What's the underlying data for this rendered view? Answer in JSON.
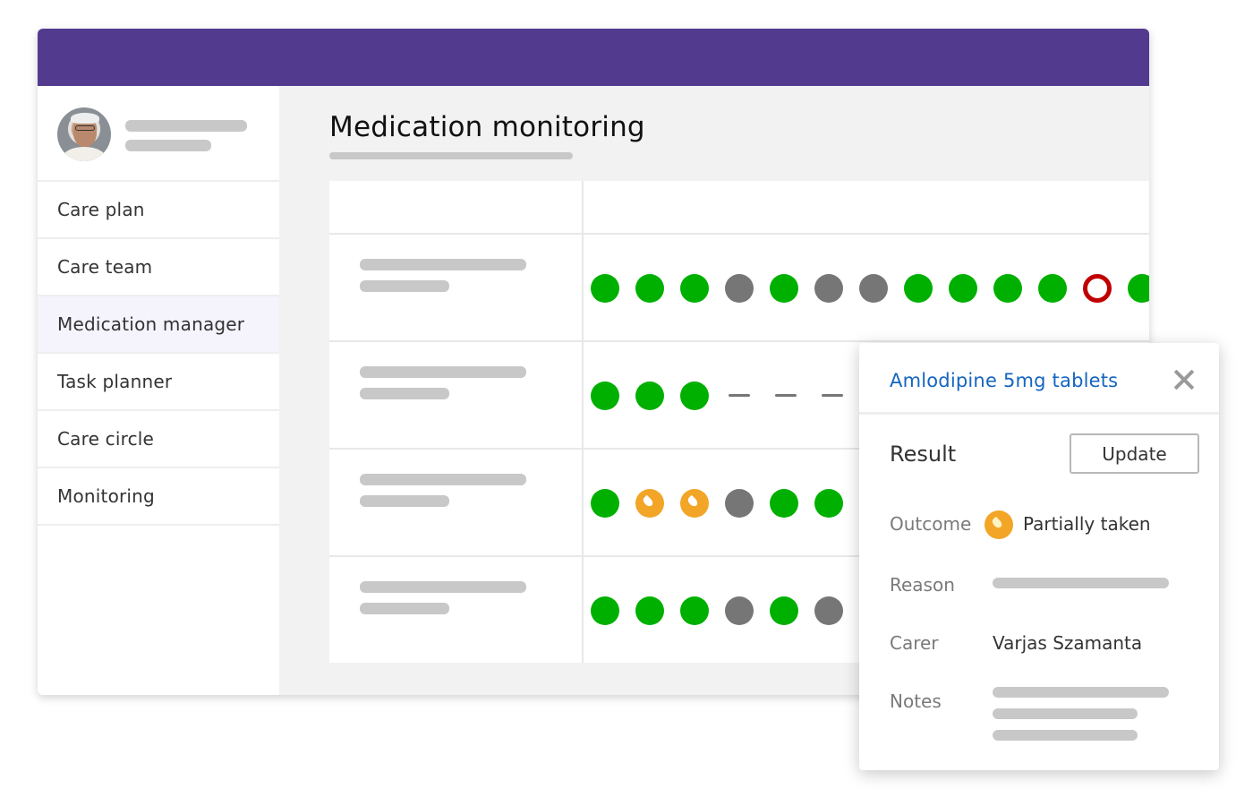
{
  "main": {
    "title": "Medication monitoring"
  },
  "sidebar": {
    "items": [
      {
        "label": "Care plan",
        "active": false
      },
      {
        "label": "Care team",
        "active": false
      },
      {
        "label": "Medication manager",
        "active": true
      },
      {
        "label": "Task planner",
        "active": false
      },
      {
        "label": "Care circle",
        "active": false
      },
      {
        "label": "Monitoring",
        "active": false
      }
    ]
  },
  "status_colors": {
    "taken": "#00b000",
    "not_due": "#767676",
    "missed": "#c00000",
    "partial": "#f2a527",
    "header": "#523b8f"
  },
  "medication_rows": [
    {
      "statuses": [
        "taken",
        "taken",
        "taken",
        "not-due",
        "taken",
        "not-due",
        "not-due",
        "taken",
        "taken",
        "taken",
        "taken",
        "missed",
        "taken"
      ]
    },
    {
      "statuses": [
        "taken",
        "taken",
        "taken",
        "none",
        "none",
        "none"
      ]
    },
    {
      "statuses": [
        "taken",
        "partial",
        "partial",
        "not-due",
        "taken",
        "taken"
      ]
    },
    {
      "statuses": [
        "taken",
        "taken",
        "taken",
        "not-due",
        "taken",
        "not-due"
      ]
    }
  ],
  "popup": {
    "title": "Amlodipine 5mg tablets",
    "result_label": "Result",
    "update_label": "Update",
    "outcome_label": "Outcome",
    "outcome_value": "Partially taken",
    "outcome_icon": "partial-dose-icon",
    "reason_label": "Reason",
    "carer_label": "Carer",
    "carer_value": "Varjas Szamanta",
    "notes_label": "Notes"
  }
}
